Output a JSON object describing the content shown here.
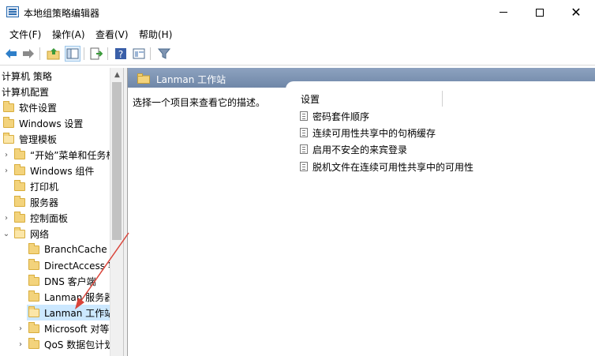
{
  "window": {
    "title": "本地组策略编辑器",
    "minimize_icon": "minimize-icon",
    "maximize_icon": "maximize-icon",
    "close_glyph": "✕"
  },
  "menu": [
    "文件(F)",
    "操作(A)",
    "查看(V)",
    "帮助(H)"
  ],
  "toolbar": {
    "icons": [
      "back-arrow-icon",
      "forward-arrow-icon",
      "up-folder-icon",
      "show-hide-tree-icon",
      "export-list-icon",
      "help-icon",
      "properties-icon",
      "filter-icon"
    ]
  },
  "tree": [
    {
      "label": "计算机 策略",
      "indent": 0,
      "type": "text"
    },
    {
      "label": "计算机配置",
      "indent": 0,
      "type": "text"
    },
    {
      "label": "软件设置",
      "indent": 0,
      "type": "folder"
    },
    {
      "label": "Windows 设置",
      "indent": 0,
      "type": "folder"
    },
    {
      "label": "管理模板",
      "indent": 0,
      "type": "folder-open"
    },
    {
      "label": "“开始”菜单和任务栏",
      "indent": 1,
      "chevron": "›"
    },
    {
      "label": "Windows 组件",
      "indent": 1,
      "chevron": "›"
    },
    {
      "label": "打印机",
      "indent": 1
    },
    {
      "label": "服务器",
      "indent": 1
    },
    {
      "label": "控制面板",
      "indent": 1,
      "chevron": "›"
    },
    {
      "label": "网络",
      "indent": 1,
      "chevron": "⌄",
      "open": true
    },
    {
      "label": "BranchCache",
      "indent": 2
    },
    {
      "label": "DirectAccess 客户端",
      "indent": 2
    },
    {
      "label": "DNS 客户端",
      "indent": 2
    },
    {
      "label": "Lanman 服务器",
      "indent": 2
    },
    {
      "label": "Lanman 工作站",
      "indent": 2,
      "selected": true
    },
    {
      "label": "Microsoft 对等",
      "indent": 2,
      "chevron": "›"
    },
    {
      "label": "QoS 数据包计划",
      "indent": 2,
      "chevron": "›"
    }
  ],
  "right": {
    "header_title": "Lanman 工作站",
    "description": "选择一个项目来查看它的描述。",
    "settings_header": "设置",
    "settings": [
      "密码套件顺序",
      "连续可用性共享中的句柄缓存",
      "启用不安全的来宾登录",
      "脱机文件在连续可用性共享中的可用性"
    ]
  },
  "colors": {
    "header_bar": "#7d93b1",
    "selection": "#cce8ff",
    "folder": "#f3d37c",
    "arrow": "#d9443a"
  }
}
